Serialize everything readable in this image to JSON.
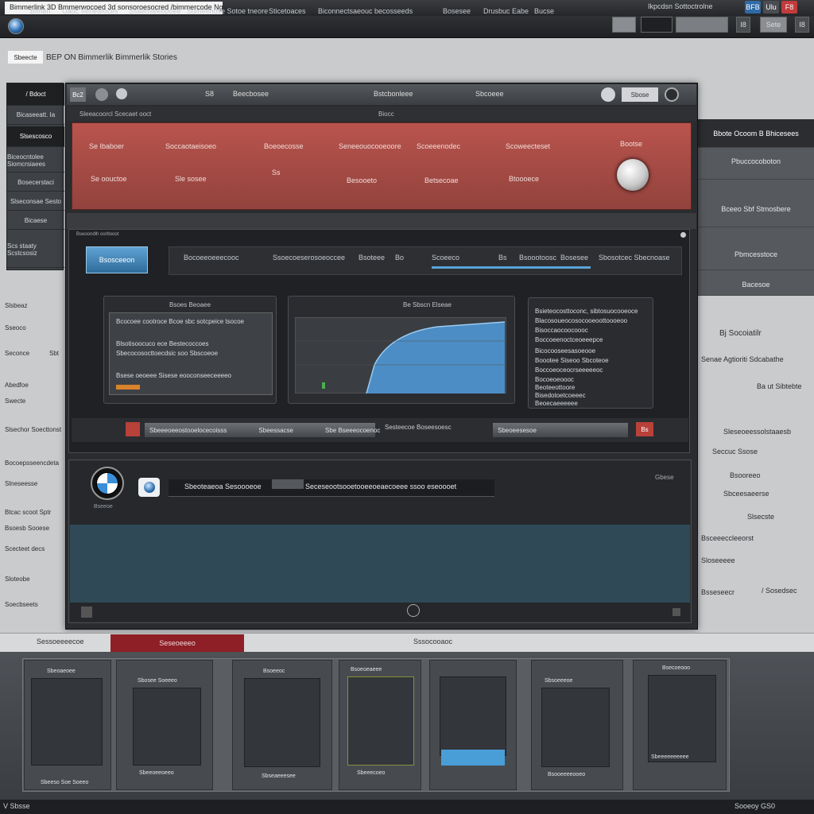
{
  "window": {
    "title": "Bimmerlink 3D  Bmmerwocoed 3d  sonsoroesocred /bimmercode Ng 3Dk",
    "title_right": "Ikpcdsn Sottoctrolne",
    "buttons": [
      "BFB",
      "Ulu",
      "F8"
    ]
  },
  "menubar": {
    "items": [
      "Bimen",
      "Uaoc Veneteoces",
      "Ssaemteeoooee",
      "Sumeendse Sotoe tneore",
      "Sticetoaces",
      "Biconnectsaeouc becosseeds",
      "Bosesee",
      "Drusbuc Eabe",
      "Bucse"
    ],
    "right_buttons": [
      "",
      "",
      "",
      "I8",
      "Sete",
      "I8"
    ]
  },
  "breadcrumb": {
    "home": "Sbeecte",
    "text": "BEP ON Bimmerlik Bimmerlik Stories"
  },
  "sidebar": {
    "items": [
      "/ Bdoct",
      "Bicaseeatt. Ia",
      "Slsescosco",
      "Biceocntolee Siomcrsiaees",
      "Bosecerstaci",
      "Slseconsae Sesto",
      "Bicaese",
      "Scs staaty Scstcsosiz"
    ]
  },
  "left_list": {
    "items": [
      "Slsbeaz",
      "Sseoco",
      "Seconce",
      "Sbt",
      "Abedfoe",
      "Swecte",
      "Slsechor Soecttonst",
      "Bocoepsseencdeta",
      "Slneseesse",
      "Btcac scoot Sptr",
      "Bsoesb Sooese",
      "Scecteet decs",
      "Sloteobe",
      "Soecbseets"
    ]
  },
  "right_panel": {
    "header": "Bbote Ocoom B Bhicesees",
    "items": [
      "Pbuccocoboton",
      "Bceeo Sbf Stmosbere",
      "Pbmcesstoce",
      "Bacesoe"
    ],
    "texts": [
      "Bj Socoiatilr",
      "Senae Agtioriti Sdcabathe",
      "Ba ut Sibtebte",
      "Sleseoeessolstaaesb",
      "Seccuc Ssose",
      "Bsooreeo",
      "Sbceesaeerse",
      "Slsecste",
      "Bsceeeccleeorst",
      "Sloseeeee",
      "Bsseseecr",
      "/ Sosedsec"
    ]
  },
  "main_window": {
    "toolbar": [
      "Bc2",
      "S8",
      "Beecbosee",
      "Bstcbonleee",
      "Sbcoeee",
      "Sbose"
    ],
    "subbar": [
      "Sleeacoorcl Scecaet ooct",
      "Biocc"
    ],
    "banner": {
      "row1": [
        "Se Ibaboer",
        "Soccaotaeisoeo",
        "Boeoecosse",
        "Seneeouocooeoore",
        "Scoeeenodec",
        "Scoweecteset",
        "Bootse"
      ],
      "row2": [
        "Se oouctoe",
        "Sle sosee",
        "Ss",
        "Besooeto",
        "Betsecoae",
        "Btoooece"
      ]
    },
    "dashboard": {
      "title": "Bseoondlh oortlooot",
      "active_tab": "Bsosceeon",
      "tabs": [
        "Bocoeeoeeecooc",
        "Ssoecoeserosoeoccee",
        "Bsoteee",
        "Bo",
        "Scoeeco",
        "Bs",
        "Bsoootoosc",
        "Bosesee",
        "Sbosotcec Sbecnoase"
      ],
      "panel1_title": "Bsoes Beoaee",
      "panel1_lines": [
        "Bcocoee cootroce Bcoe sbc sotcpeice tsocoe",
        "Blsotisoocuco ece Bestecoccoes",
        "Sbecocosocttoecdsic soo Sbscoeoe",
        "Bsese oeoeee Sisese eooconseeceeeeo"
      ],
      "panel2_title": "Be Sbscn Elseae",
      "panel3_lines": [
        "Bsieteocosttoconc, sibtosuocooeoce",
        "Blacosoueocosocooeoottoooeoo",
        "Bisoccaocoocoooc",
        "Boccoeenoctceoeeepce",
        "Bicocooseesasoeooe",
        "Boootee Siseoo Sbcoteoe",
        "Boccoeoceocrseeeeeoc",
        "Bocoeoeoooc",
        "Beoteeottoore",
        "Bisedotoetcoeeec",
        "Beoecaeeeeee"
      ],
      "status": [
        "Sbeeeoeeostooelocecoisss",
        "Sbeessacse",
        "Sbe Bseeeocoenoc",
        "Bse",
        "Sesteecoe Boseesoesc",
        "Sbeoeesesoe",
        "Bs"
      ]
    },
    "bmw": {
      "label": "Bseeoe",
      "field_left": "Sbeoteaeoa Sesoooeoe",
      "field_right": "Seceseootsooetooeeoeaecoeee ssoo eseoooet",
      "corner": "Gbese"
    }
  },
  "bottom_tabs": {
    "left": "Sessoeeeecoe",
    "active": "Seseoeeeo",
    "right": "Sssocooaoc"
  },
  "thumbnails": [
    {
      "label": "Sbeoaeoee",
      "footer": "Sbeeso Soe Soeeo"
    },
    {
      "label": "Sbosee Soeeeo",
      "footer": "Sbeeoeeoeeo"
    },
    {
      "label": "Bsoeeoc",
      "footer": "Sbseaeeesee"
    },
    {
      "label": "Bsoeoeaeee",
      "footer": "Sbeeecoeo"
    },
    {
      "label": "",
      "footer": ""
    },
    {
      "label": "Sbsoeeeoe",
      "footer": "Bsooeeeeooeo"
    },
    {
      "label": "Bsecoeooo",
      "footer": "Sbeeeeeeeeee"
    }
  ],
  "statusbar": {
    "left": "V Sbsse",
    "right": "Sooeoy  GS0"
  },
  "colors": {
    "banner": "#b9544d",
    "accent_blue": "#3b8ed8",
    "active_tab": "#8e1f26",
    "teal": "#2f4957"
  }
}
